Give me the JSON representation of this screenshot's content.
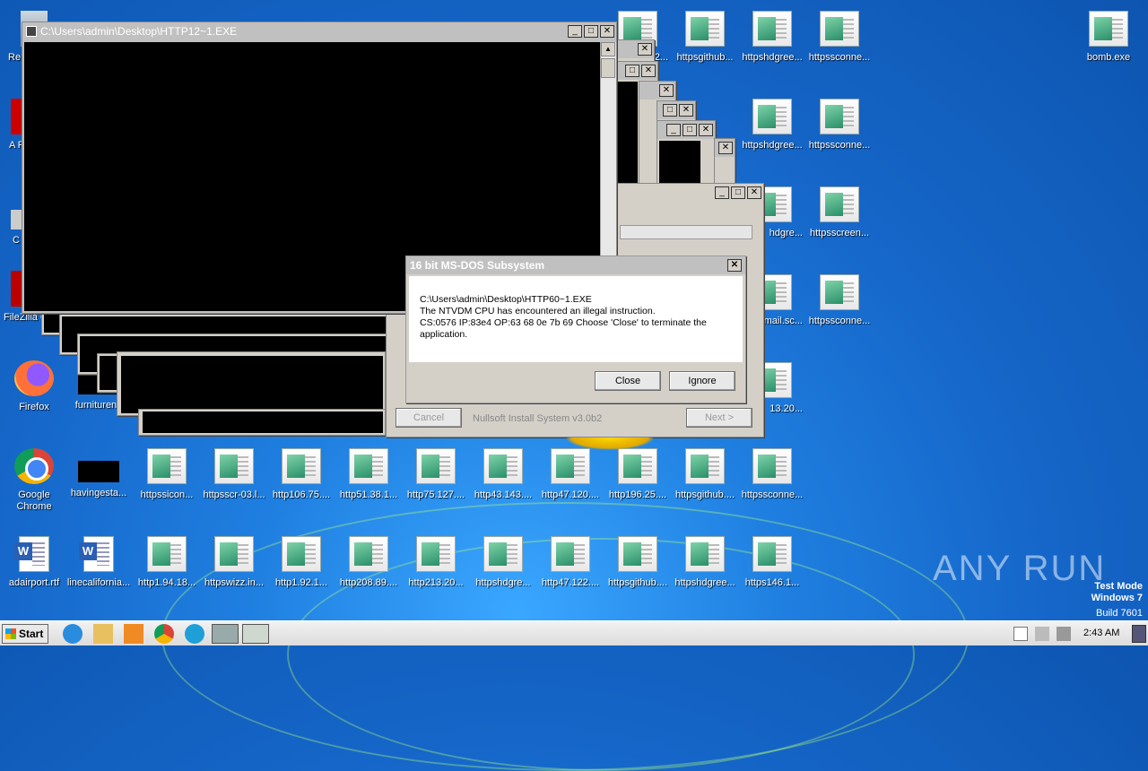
{
  "desktop": {
    "left_column": [
      {
        "label": "Re",
        "icon": "recycle-bin-icon"
      },
      {
        "label": "A Re",
        "icon": "adobe-reader-icon"
      },
      {
        "label": "C",
        "icon": "ccleaner-icon"
      },
      {
        "label": "FileZilla C",
        "icon": "filezilla-icon"
      },
      {
        "label": "Firefox",
        "icon": "firefox-icon"
      },
      {
        "label": "Google Chrome",
        "icon": "chrome-icon"
      },
      {
        "label": "adairport.rtf",
        "icon": "word-doc-icon"
      }
    ],
    "col2": [
      {
        "label": "furnitureno",
        "icon": "black-thumbnail-icon"
      },
      {
        "label": "havingesta...",
        "icon": "black-thumbnail-icon"
      },
      {
        "label": "linecalifornia...",
        "icon": "word-doc-icon"
      }
    ],
    "row_bottom1": [
      "httpssicon...",
      "httpsscr-03.l...",
      "http106.75....",
      "http51.38.1...",
      "http75.127....",
      "http43.143....",
      "http47.120....",
      "http196.25....",
      "httpsgithub....",
      "httpssconne..."
    ],
    "row_bottom2": [
      "http1.94.18...",
      "httpswizz.in...",
      "http1.92.1...",
      "http208.89....",
      "http213.20...",
      "httpshdgre...",
      "http47.122....",
      "httpsgithub....",
      "httpshdgree...",
      "https146.1..."
    ],
    "right_grid": [
      [
        "httpsgithub...",
        "httpshdgree...",
        "httpssconne..."
      ],
      [
        "httpshdgree...",
        "httpssconne..."
      ],
      [
        "hdgre...",
        "httpsscreen..."
      ],
      [
        "mail.sc...",
        "httpssconne..."
      ],
      [
        "13.20..."
      ]
    ],
    "bomb_label": "bomb.exe",
    "partial_label_top": "42...",
    "watermark": {
      "brand": "ANY RUN",
      "test_mode": "Test Mode",
      "os": "Windows 7",
      "build": "Build 7601"
    }
  },
  "console_window": {
    "title": "C:\\Users\\admin\\Desktop\\HTTP12~1.EXE",
    "buttons": {
      "min": "_",
      "max": "□",
      "close": "✕"
    }
  },
  "installer": {
    "cancel_label": "Cancel",
    "brand_label": "Nullsoft Install System v3.0b2",
    "next_label": "Next >"
  },
  "dialog": {
    "title": "16 bit MS-DOS Subsystem",
    "line1": "C:\\Users\\admin\\Desktop\\HTTP60~1.EXE",
    "line2": "The NTVDM CPU has encountered an illegal instruction.",
    "line3": "CS:0576 IP:83e4 OP:63 68 0e 7b 69 Choose 'Close' to terminate the",
    "line4": "application.",
    "close_label": "Close",
    "ignore_label": "Ignore"
  },
  "taskbar": {
    "start_label": "Start",
    "clock": "2:43 AM"
  },
  "colors": {
    "desktop": "#1566c8",
    "console": "#000000",
    "dialog_bg": "#d4d0c8"
  }
}
